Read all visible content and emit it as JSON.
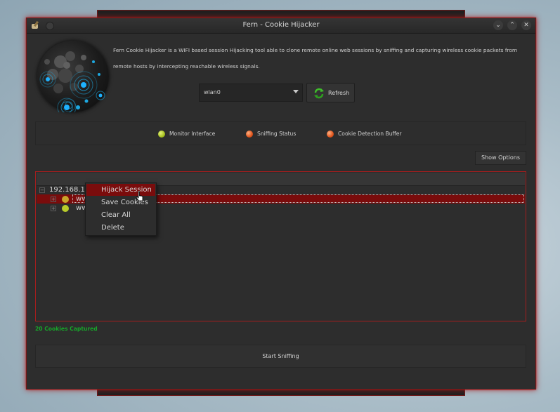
{
  "window": {
    "title": "Fern - Cookie Hijacker",
    "controls": [
      "⌄",
      "⌃",
      "✕"
    ]
  },
  "header": {
    "description": "Fern Cookie Hijacker is a WIFI based session Hijacking tool able to clone remote online web sessions by sniffing and capturing wireless cookie packets from remote hosts by intercepting reachable wireless signals."
  },
  "interface": {
    "selected": "wlan0",
    "refresh_label": "Refresh"
  },
  "status": {
    "items": [
      {
        "label": "Monitor Interface",
        "color": "green"
      },
      {
        "label": "Sniffing Status",
        "color": "red"
      },
      {
        "label": "Cookie Detection Buffer",
        "color": "red"
      }
    ]
  },
  "show_options_label": "Show Options",
  "tree": {
    "host": "192.168.1",
    "children": [
      {
        "label": "ww",
        "color": "#c9a52a",
        "selected": true
      },
      {
        "label": "ww",
        "color": "#b9cc2a",
        "selected": false
      }
    ]
  },
  "context_menu": {
    "items": [
      "Hijack Session",
      "Save Cookies",
      "Clear All",
      "Delete"
    ],
    "highlighted": 0
  },
  "cookies_captured": "20 Cookies Captured",
  "start_label": "Start Sniffing",
  "colors": {
    "accent": "#a51e1e",
    "selection": "#7a0c0c",
    "captured_text": "#17a52a"
  }
}
